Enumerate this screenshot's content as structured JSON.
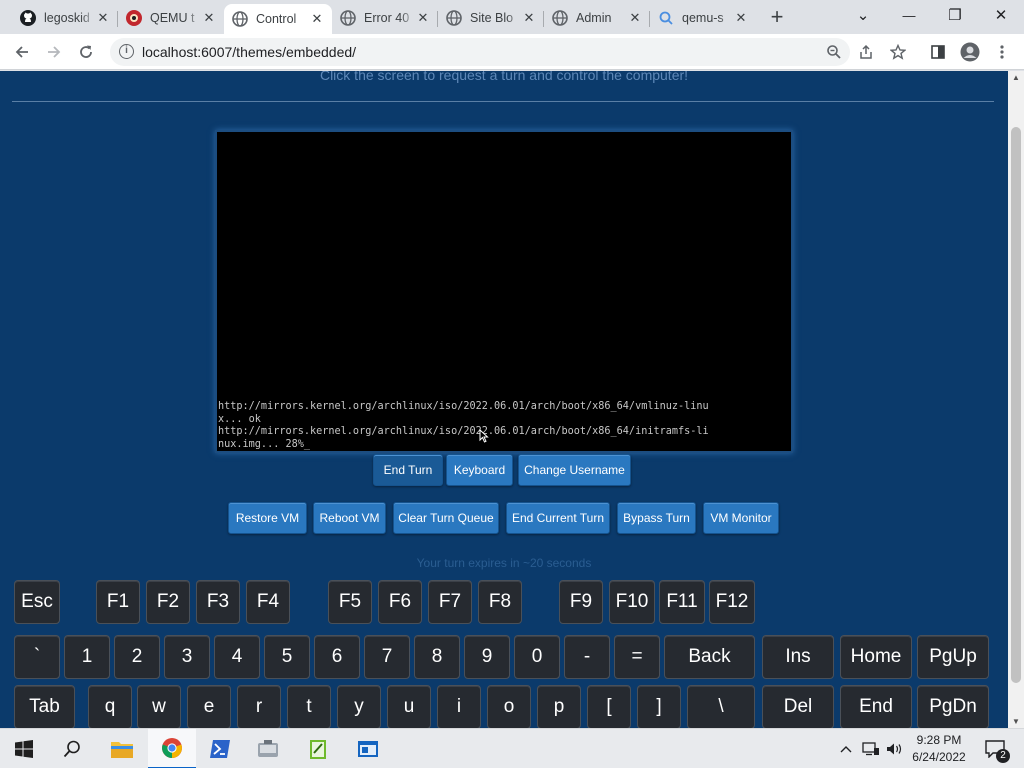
{
  "browser": {
    "tabs": [
      {
        "title": "legoskid",
        "icon": "github-icon"
      },
      {
        "title": "QEMU t",
        "icon": "qemu-icon"
      },
      {
        "title": "Control",
        "icon": "globe-icon",
        "active": true
      },
      {
        "title": "Error 40",
        "icon": "globe-icon"
      },
      {
        "title": "Site Blo",
        "icon": "globe-icon"
      },
      {
        "title": "Admin",
        "icon": "globe-icon"
      },
      {
        "title": "qemu-s",
        "icon": "search-icon"
      }
    ],
    "close_glyph": "✕",
    "new_tab_glyph": "+",
    "url": "localhost:6007/themes/embedded/",
    "window_controls": {
      "tab_search": "⌄",
      "minimize": "—",
      "maximize": "❐",
      "close": "✕"
    }
  },
  "page": {
    "hint": "Click the screen to request a turn and control the computer!",
    "console_lines": [
      "http://mirrors.kernel.org/archlinux/iso/2022.06.01/arch/boot/x86_64/vmlinuz-linu",
      "x... ok",
      "http://mirrors.kernel.org/archlinux/iso/2022.06.01/arch/boot/x86_64/initramfs-li",
      "nux.img... 28%_"
    ],
    "controls": {
      "end_turn": "End Turn",
      "keyboard": "Keyboard",
      "change_username": "Change Username"
    },
    "admin": {
      "restore_vm": "Restore VM",
      "reboot_vm": "Reboot VM",
      "clear_turn_queue": "Clear Turn Queue",
      "end_current_turn": "End Current Turn",
      "bypass_turn": "Bypass Turn",
      "vm_monitor": "VM Monitor"
    },
    "turn_timer": "Your turn expires in ~20 seconds",
    "keyboard": {
      "function_row": [
        "Esc",
        "F1",
        "F2",
        "F3",
        "F4",
        "F5",
        "F6",
        "F7",
        "F8",
        "F9",
        "F10",
        "F11",
        "F12"
      ],
      "number_row": [
        "`",
        "1",
        "2",
        "3",
        "4",
        "5",
        "6",
        "7",
        "8",
        "9",
        "0",
        "-",
        "=",
        "Back",
        "Ins",
        "Home",
        "PgUp"
      ],
      "qwerty_row": [
        "Tab",
        "q",
        "w",
        "e",
        "r",
        "t",
        "y",
        "u",
        "i",
        "o",
        "p",
        "[",
        "]",
        "\\",
        "Del",
        "End",
        "PgDn"
      ]
    }
  },
  "taskbar": {
    "apps": [
      "windows-start-icon",
      "search-icon",
      "file-explorer-icon",
      "chrome-icon",
      "powershell-icon",
      "tool-icon",
      "notepad-icon",
      "app-window-icon"
    ],
    "time": "9:28 PM",
    "date": "6/24/2022",
    "notifications": "2"
  },
  "colors": {
    "page_bg": "#0b3a6b",
    "button": "#2a78c0",
    "key_bg": "#262a30"
  }
}
